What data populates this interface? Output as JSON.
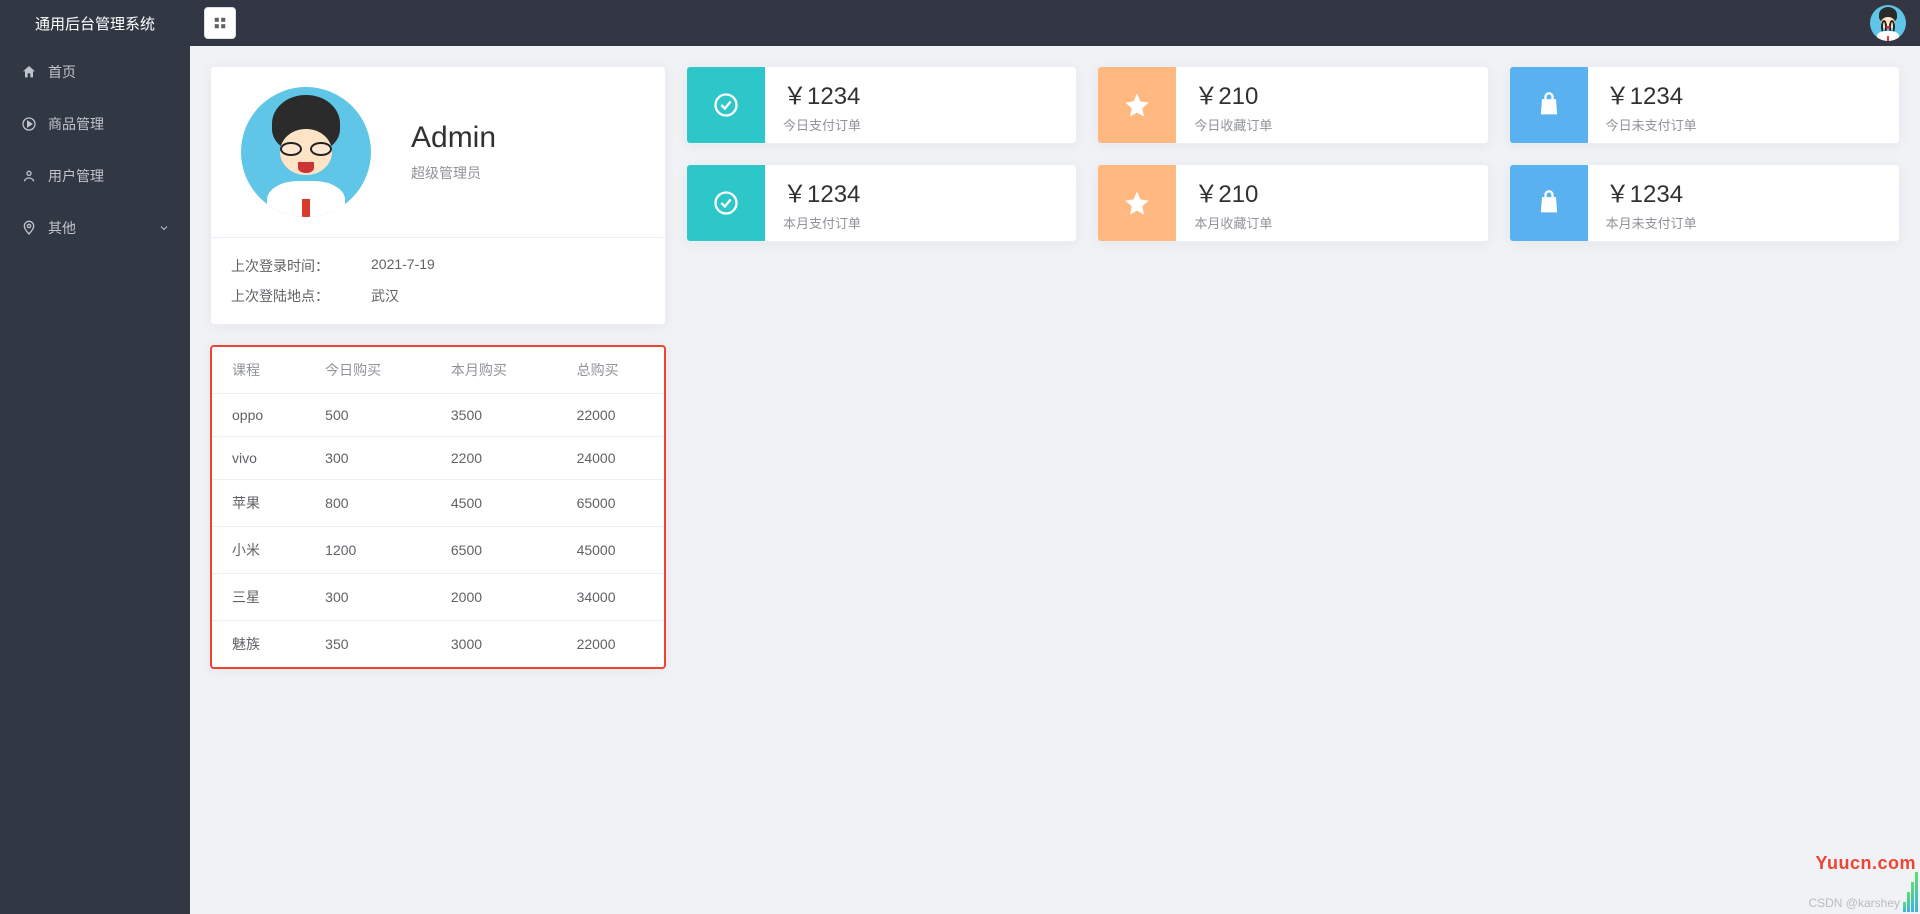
{
  "sidebar": {
    "title": "通用后台管理系统",
    "items": [
      {
        "label": "首页",
        "icon": "home-icon"
      },
      {
        "label": "商品管理",
        "icon": "play-circle-icon"
      },
      {
        "label": "用户管理",
        "icon": "user-icon"
      },
      {
        "label": "其他",
        "icon": "location-icon",
        "expandable": true
      }
    ]
  },
  "user": {
    "name": "Admin",
    "role": "超级管理员",
    "info": [
      {
        "label": "上次登录时间：",
        "value": "2021-7-19"
      },
      {
        "label": "上次登陆地点：",
        "value": "武汉"
      }
    ]
  },
  "table": {
    "headers": [
      "课程",
      "今日购买",
      "本月购买",
      "总购买"
    ],
    "rows": [
      [
        "oppo",
        "500",
        "3500",
        "22000"
      ],
      [
        "vivo",
        "300",
        "2200",
        "24000"
      ],
      [
        "苹果",
        "800",
        "4500",
        "65000"
      ],
      [
        "小米",
        "1200",
        "6500",
        "45000"
      ],
      [
        "三星",
        "300",
        "2000",
        "34000"
      ],
      [
        "魅族",
        "350",
        "3000",
        "22000"
      ]
    ]
  },
  "stats": [
    {
      "value": "￥1234",
      "label": "今日支付订单",
      "color": "teal",
      "icon": "check-circle-icon"
    },
    {
      "value": "￥210",
      "label": "今日收藏订单",
      "color": "orange",
      "icon": "star-icon"
    },
    {
      "value": "￥1234",
      "label": "今日未支付订单",
      "color": "blue",
      "icon": "bag-icon"
    },
    {
      "value": "￥1234",
      "label": "本月支付订单",
      "color": "teal",
      "icon": "check-circle-icon"
    },
    {
      "value": "￥210",
      "label": "本月收藏订单",
      "color": "orange",
      "icon": "star-icon"
    },
    {
      "value": "￥1234",
      "label": "本月未支付订单",
      "color": "blue",
      "icon": "bag-icon"
    }
  ],
  "watermarks": {
    "site": "Yuucn.com",
    "csdn": "CSDN @karshey"
  }
}
